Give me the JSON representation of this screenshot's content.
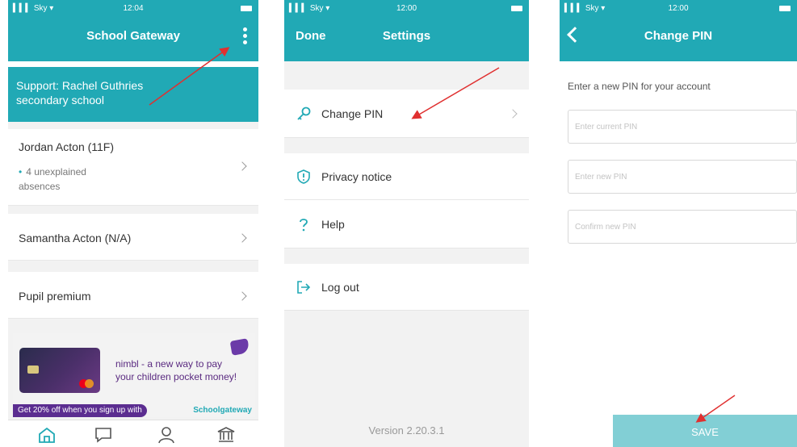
{
  "screen1": {
    "status": {
      "carrier": "▍▍▍ Sky ▾",
      "time": "12:04"
    },
    "header": {
      "title": "School Gateway"
    },
    "support": {
      "line1": "Support: Rachel Guthries",
      "line2": "secondary school"
    },
    "students": [
      {
        "name": "Jordan Acton (11F)",
        "note_line1": "4 unexplained",
        "note_line2": "absences"
      },
      {
        "name": "Samantha Acton (N/A)"
      }
    ],
    "pupil_premium": "Pupil premium",
    "banner": {
      "line1": "nimbl - a new way to pay",
      "line2": "your children pocket money!",
      "promo": "Get 20% off when you sign up with",
      "brand": "Schoolgateway"
    },
    "tabs": [
      "home-icon",
      "messages-icon",
      "account-icon",
      "school-icon"
    ]
  },
  "screen2": {
    "status": {
      "carrier": "▍▍▍ Sky ▾",
      "time": "12:00"
    },
    "header": {
      "left": "Done",
      "title": "Settings"
    },
    "items": {
      "change_pin": "Change PIN",
      "privacy": "Privacy notice",
      "help": "Help",
      "logout": "Log out"
    },
    "version": "Version 2.20.3.1"
  },
  "screen3": {
    "status": {
      "carrier": "▍▍▍ Sky ▾",
      "time": "12:00"
    },
    "header": {
      "title": "Change PIN"
    },
    "instruction": "Enter a new PIN for your account",
    "fields": {
      "current": "Enter current PIN",
      "new": "Enter new PIN",
      "confirm": "Confirm new PIN"
    },
    "save": "SAVE"
  },
  "colors": {
    "teal": "#21a9b5",
    "save_disabled": "#82cfd5",
    "annotation": "#e03030",
    "nimbl_purple": "#5b2d90"
  }
}
